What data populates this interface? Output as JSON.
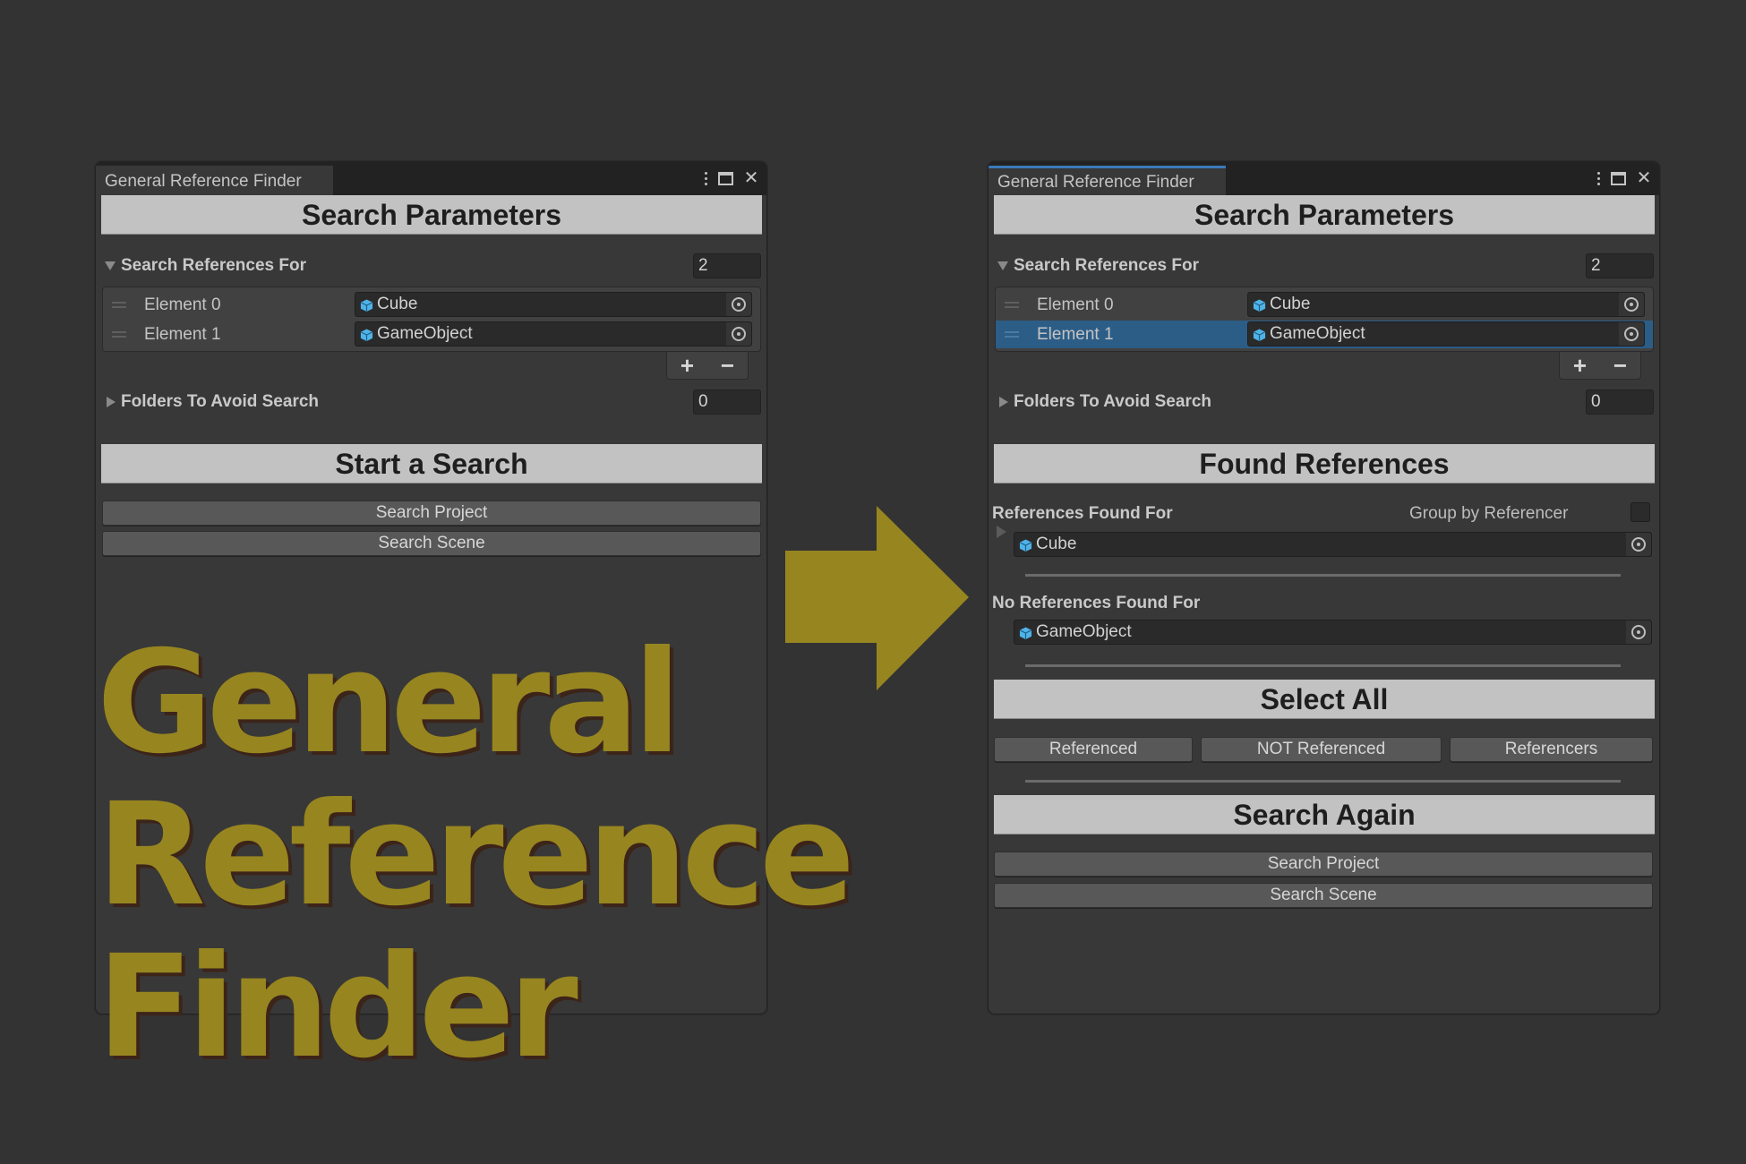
{
  "window_title": "General Reference Finder",
  "window_controls": {
    "menu": "kebab-menu-icon",
    "maximize": "maximize-icon",
    "close": "✕"
  },
  "before_panel": {
    "header": "Search Parameters",
    "search_refs": {
      "label": "Search References For",
      "count": "2",
      "elements": [
        {
          "label": "Element 0",
          "value": "Cube"
        },
        {
          "label": "Element 1",
          "value": "GameObject"
        }
      ],
      "add": "+",
      "remove": "−"
    },
    "folders": {
      "label": "Folders To Avoid Search",
      "count": "0"
    },
    "start_header": "Start a Search",
    "buttons": {
      "search_project": "Search Project",
      "search_scene": "Search Scene"
    }
  },
  "after_panel": {
    "header": "Search Parameters",
    "search_refs": {
      "label": "Search References For",
      "count": "2",
      "elements": [
        {
          "label": "Element 0",
          "value": "Cube",
          "selected": false
        },
        {
          "label": "Element 1",
          "value": "GameObject",
          "selected": true
        }
      ],
      "add": "+",
      "remove": "−"
    },
    "folders": {
      "label": "Folders To Avoid Search",
      "count": "0"
    },
    "found_header": "Found References",
    "references_found_label": "References Found For",
    "group_by_label": "Group by Referencer",
    "group_by_checked": false,
    "found_items": [
      "Cube"
    ],
    "no_references_label": "No References Found For",
    "not_found_items": [
      "GameObject"
    ],
    "select_all_header": "Select All",
    "select_buttons": {
      "referenced": "Referenced",
      "not_referenced": "NOT Referenced",
      "referencers": "Referencers"
    },
    "search_again_header": "Search Again",
    "buttons": {
      "search_project": "Search Project",
      "search_scene": "Search Scene"
    }
  },
  "overlay_title": {
    "line1": "General",
    "line2": "Reference",
    "line3": "Finder"
  },
  "colors": {
    "accent_gold": "#978520",
    "selection_blue": "#2c5d87",
    "active_tab": "#3a79bb",
    "cube_icon": "#4fb3e8"
  }
}
